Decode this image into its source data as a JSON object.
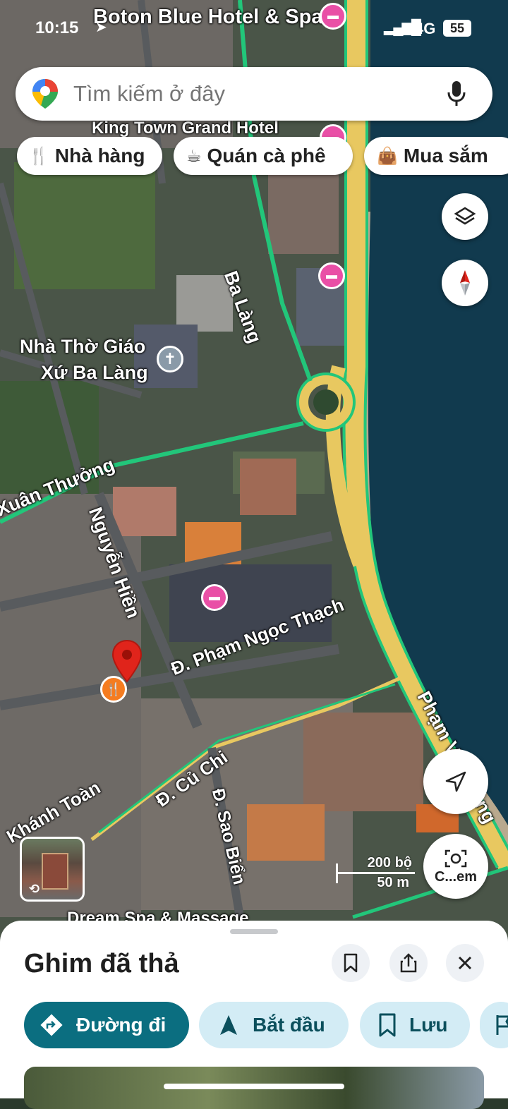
{
  "status": {
    "time": "10:15",
    "network": "4G",
    "battery": "55"
  },
  "search": {
    "placeholder": "Tìm kiếm ở đây"
  },
  "chips": [
    {
      "label": "Nhà hàng",
      "icon": "fork-knife-icon"
    },
    {
      "label": "Quán cà phê",
      "icon": "coffee-cup-icon"
    },
    {
      "label": "Mua sắm",
      "icon": "shopping-bag-icon"
    }
  ],
  "map": {
    "places": {
      "hotel_top": "Boton Blue Hotel & Spa",
      "hotel_second": "King Town Grand Hotel",
      "church_line1": "Nhà Thờ Giáo",
      "church_line2": "Xứ Ba Làng",
      "spa_bottom": "Dream Spa & Massage"
    },
    "streets": {
      "ba_lang": "Ba Làng",
      "xuan_thuong": "Xuân Thưởng",
      "nguyen_hien": "Nguyễn Hiền",
      "pham_ngoc_thach": "Đ. Phạm Ngọc Thạch",
      "cu_chi": "Đ. Củ Chi",
      "sao_bien": "Đ. Sao Biển",
      "khanh_toan": "Khánh Toàn",
      "pham_van_dong": "Phạm Văn Đồng"
    },
    "scale": {
      "imperial": "200 bộ",
      "metric": "50 m"
    },
    "lens_label": "C...em"
  },
  "sheet": {
    "title": "Ghim đã thả",
    "actions": {
      "directions": "Đường đi",
      "start": "Bắt đầu",
      "save": "Lưu"
    }
  },
  "colors": {
    "primary": "#0b6e80",
    "chip_light": "#d3ecf5",
    "road_green": "#22c67a",
    "road_yellow": "#e8c860",
    "hotel_pink": "#e94fa6",
    "pin_red": "#e0241b",
    "restaurant_orange": "#f57c20"
  }
}
